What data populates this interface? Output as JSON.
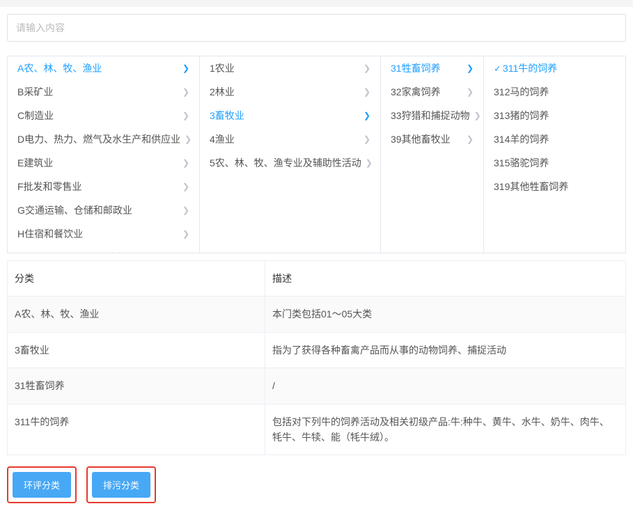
{
  "search": {
    "placeholder": "请输入内容"
  },
  "columns": {
    "c1": [
      {
        "label": "A农、林、牧、渔业",
        "active": true
      },
      {
        "label": "B采矿业",
        "active": false
      },
      {
        "label": "C制造业",
        "active": false
      },
      {
        "label": "D电力、热力、燃气及水生产和供应业",
        "active": false
      },
      {
        "label": "E建筑业",
        "active": false
      },
      {
        "label": "F批发和零售业",
        "active": false
      },
      {
        "label": "G交通运输、仓储和邮政业",
        "active": false
      },
      {
        "label": "H住宿和餐饮业",
        "active": false
      },
      {
        "label": "I信息传输、软件和信息技术服务业",
        "active": false
      }
    ],
    "c2": [
      {
        "label": "1农业",
        "active": false
      },
      {
        "label": "2林业",
        "active": false
      },
      {
        "label": "3畜牧业",
        "active": true
      },
      {
        "label": "4渔业",
        "active": false
      },
      {
        "label": "5农、林、牧、渔专业及辅助性活动",
        "active": false
      }
    ],
    "c3": [
      {
        "label": "31牲畜饲养",
        "active": true
      },
      {
        "label": "32家禽饲养",
        "active": false
      },
      {
        "label": "33狩猎和捕捉动物",
        "active": false
      },
      {
        "label": "39其他畜牧业",
        "active": false
      }
    ],
    "c4": [
      {
        "label": "311牛的饲养",
        "active": true,
        "checked": true
      },
      {
        "label": "312马的饲养",
        "active": false
      },
      {
        "label": "313猪的饲养",
        "active": false
      },
      {
        "label": "314羊的饲养",
        "active": false
      },
      {
        "label": "315骆驼饲养",
        "active": false
      },
      {
        "label": "319其他牲畜饲养",
        "active": false
      }
    ]
  },
  "table": {
    "headers": {
      "category": "分类",
      "description": "描述"
    },
    "rows": [
      {
        "category": "A农、林、牧、渔业",
        "description": "本门类包括01～05大类"
      },
      {
        "category": "3畜牧业",
        "description": "指为了获得各种畜禽产品而从事的动物饲养、捕捉活动"
      },
      {
        "category": "31牲畜饲养",
        "description": "/"
      },
      {
        "category": "311牛的饲养",
        "description": "包括对下列牛的饲养活动及相关初级产品:牛:种牛、黄牛、水牛、奶牛、肉牛、牦牛、牛犊、能（牦牛绒）。"
      }
    ]
  },
  "buttons": {
    "eia": "环评分类",
    "emission": "排污分类"
  }
}
